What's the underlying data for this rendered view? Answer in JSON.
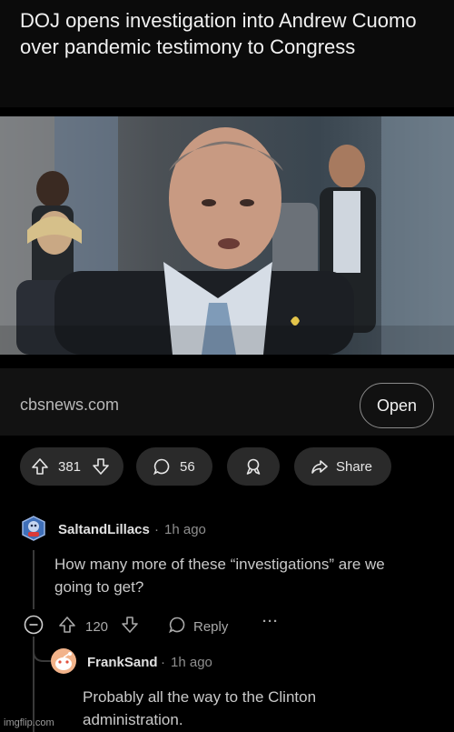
{
  "post": {
    "title": "DOJ opens investigation into Andrew Cuomo over pandemic testimony to Congress",
    "link_domain": "cbsnews.com",
    "open_label": "Open"
  },
  "actions": {
    "upvotes": "381",
    "comments": "56",
    "share_label": "Share"
  },
  "comments": [
    {
      "author": "SaltandLillacs",
      "separator": "·",
      "time": "1h ago",
      "text": "How many more of these “investigations” are we going to get?",
      "votes": "120",
      "reply_label": "Reply",
      "more_label": "···"
    },
    {
      "author": "FrankSand",
      "separator": "·",
      "time": "1h ago",
      "text": "Probably all the way to the Clinton administration."
    }
  ],
  "watermark": "imgflip.com",
  "colors": {
    "background": "#000000",
    "pill": "#2a2a2a",
    "text": "#e6e6e6",
    "muted": "#8e8e8e"
  },
  "icons": [
    "upvote-icon",
    "downvote-icon",
    "comment-icon",
    "award-icon",
    "share-icon",
    "collapse-icon",
    "reply-icon",
    "more-icon",
    "avatar"
  ]
}
